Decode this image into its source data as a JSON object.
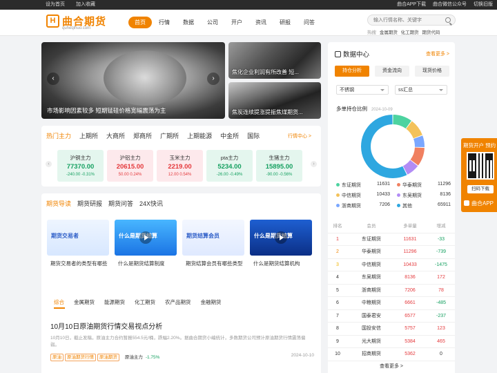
{
  "topbar": {
    "set_home": "设为首页",
    "bookmark": "加入收藏",
    "app_download": "曲合APP下载",
    "wechat": "曲合微信公众号",
    "switch_old": "切换旧版"
  },
  "logo": {
    "mark": "H",
    "name": "曲合期货",
    "sub": "quheqihuo.com"
  },
  "nav": [
    "首页",
    "行情",
    "数据",
    "公司",
    "开户",
    "资讯",
    "研报",
    "问答"
  ],
  "search": {
    "placeholder": "输入行情名称、关键字"
  },
  "hot": {
    "label": "热搜",
    "items": [
      "金属期货",
      "化工期货",
      "期货代码"
    ]
  },
  "banner": {
    "caption": "市场影响因素较多 短期锰硅价格宽幅震荡为主",
    "prev": "‹",
    "next": "›"
  },
  "thumbs": [
    {
      "caption": "焦化企业利润有所改善 短..."
    },
    {
      "caption": "焦炭连续提涨提振焦煤期货..."
    }
  ],
  "market": {
    "tabs": [
      "热门主力",
      "上期所",
      "大商所",
      "郑商所",
      "广期所",
      "上期能源",
      "中金所",
      "国际"
    ],
    "more": "行情中心 >",
    "cards": [
      {
        "name": "沪铜主力",
        "price": "77370.00",
        "chg": "-240.00",
        "pct": "-0.31%",
        "dir": "dn"
      },
      {
        "name": "沪铝主力",
        "price": "20615.00",
        "chg": "50.00",
        "pct": "0.24%",
        "dir": "up"
      },
      {
        "name": "玉米主力",
        "price": "2219.00",
        "chg": "12.00",
        "pct": "0.54%",
        "dir": "up"
      },
      {
        "name": "pta主力",
        "price": "5234.00",
        "chg": "-26.00",
        "pct": "-0.49%",
        "dir": "dn"
      },
      {
        "name": "生猪主力",
        "price": "15895.00",
        "chg": "-90.00",
        "pct": "-0.56%",
        "dir": "dn"
      }
    ]
  },
  "guide": {
    "tabs": [
      "期货导读",
      "期货研报",
      "期货问答",
      "24X快讯"
    ],
    "videos": [
      {
        "tag": "期货交易者",
        "title": "期货交易者的类型有哪些"
      },
      {
        "tag": "什么是期货结算",
        "title": "什么是期货结算制度"
      },
      {
        "tag": "期货结算会员",
        "title": "期货结算会员有哪些类型"
      },
      {
        "tag": "什么是期货结算",
        "title": "什么是期货结算机构"
      }
    ],
    "sub_tabs": [
      "综合",
      "金属期货",
      "能源期货",
      "化工期货",
      "农产品期货",
      "金融期货"
    ],
    "article": {
      "title": "10月10日原油期货行情交易视点分析",
      "desc": "10月10日，截止发稿，原油主力合约暂报554.5元/桶，跌幅2.20%。据曲合期货小编统计，多数期货公司预计原油期货行情震荡偏弱。",
      "tags": [
        "原油",
        "原油期货行情",
        "原油期货"
      ],
      "quote_name": "原油主力",
      "quote_pct": "-1.75%",
      "date": "2024-10-10"
    }
  },
  "data_center": {
    "title": "数据中心",
    "more": "查看更多 >",
    "pills": [
      "持仓分析",
      "资金流向",
      "现货价格"
    ],
    "selects": [
      "不锈钢",
      "ss汇总"
    ],
    "chart_title": "多单持仓比例",
    "chart_date": "2024-10-09",
    "chart_data": {
      "type": "pie",
      "title": "多单持仓比例",
      "categories": [
        "东证期货",
        "中信期货",
        "浙商期货",
        "华泰期货",
        "东吴期货",
        "其他"
      ],
      "values": [
        11631,
        10433,
        7206,
        11296,
        8136,
        65911
      ],
      "colors": [
        "#4dd3a0",
        "#f3c25a",
        "#7aa7ff",
        "#f08060",
        "#b28cf5",
        "#2ea7e0"
      ]
    },
    "table": {
      "headers": [
        "排名",
        "会员",
        "多单量",
        "增减"
      ],
      "rows": [
        [
          "1",
          "东证期货",
          "11631",
          "-33"
        ],
        [
          "2",
          "华泰期货",
          "11296",
          "-739"
        ],
        [
          "3",
          "中信期货",
          "10433",
          "-1475"
        ],
        [
          "4",
          "东吴期货",
          "8136",
          "172"
        ],
        [
          "5",
          "浙商期货",
          "7206",
          "78"
        ],
        [
          "6",
          "中粮期货",
          "6661",
          "-485"
        ],
        [
          "7",
          "国泰君安",
          "6577",
          "-237"
        ],
        [
          "8",
          "国投安信",
          "5757",
          "123"
        ],
        [
          "9",
          "光大期货",
          "5384",
          "465"
        ],
        [
          "10",
          "招商期货",
          "5362",
          "0"
        ]
      ]
    },
    "footer_more": "查看更多 >"
  },
  "float_panel": {
    "title": "期货开户 预约",
    "scan": "扫码下载",
    "app": "曲合APP"
  }
}
